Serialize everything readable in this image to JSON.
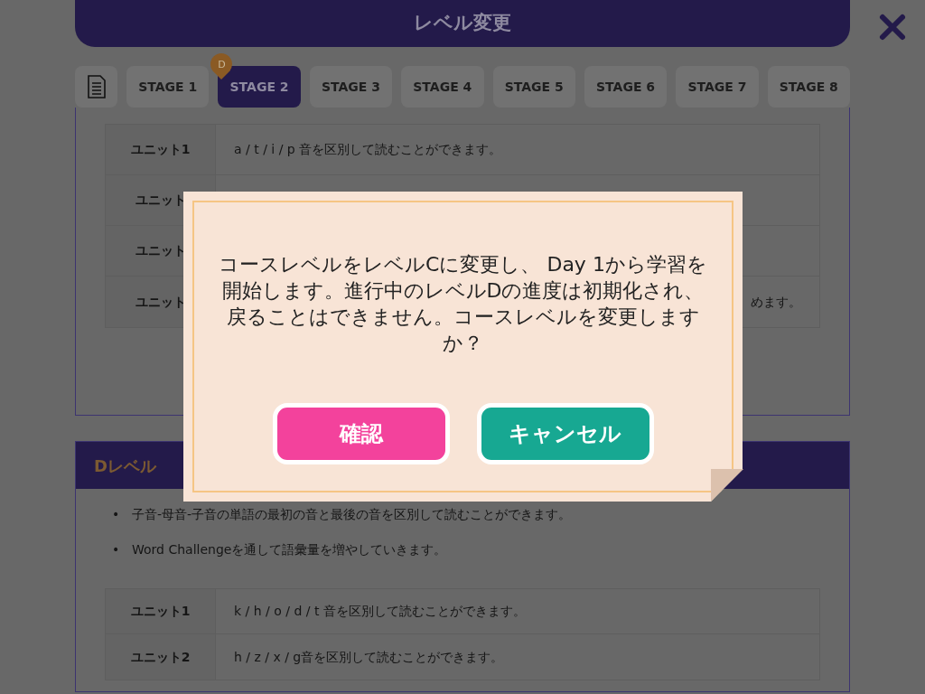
{
  "header": {
    "title": "レベル変更"
  },
  "tabs": [
    {
      "label": "STAGE 1",
      "selected": false
    },
    {
      "label": "STAGE 2",
      "selected": true,
      "badge": "D"
    },
    {
      "label": "STAGE 3",
      "selected": false
    },
    {
      "label": "STAGE 4",
      "selected": false
    },
    {
      "label": "STAGE 5",
      "selected": false
    },
    {
      "label": "STAGE 6",
      "selected": false
    },
    {
      "label": "STAGE 7",
      "selected": false
    },
    {
      "label": "STAGE 8",
      "selected": false
    }
  ],
  "sections": [
    {
      "units": [
        {
          "unit": "ユニット1",
          "description": "a / t / i / p 音を区別して読むことができます。"
        },
        {
          "unit": "ユニット"
        },
        {
          "unit": "ユニット"
        },
        {
          "unit": "ユニット",
          "description": "めます。"
        }
      ]
    },
    {
      "title": "Dレベル",
      "bullets": [
        {
          "marker": "•",
          "text": "子音-母音-子音の単語の最初の音と最後の音を区別して読むことができます。"
        },
        {
          "marker": "•",
          "text": "Word Challengeを通して語彙量を増やしていきます。"
        }
      ],
      "units": [
        {
          "unit": "ユニット1",
          "description": "k / h / o / d / t 音を区別して読むことができます。"
        },
        {
          "unit": "ユニット2",
          "description": "h / z / x / g音を区別して読むことができます。"
        }
      ]
    }
  ],
  "dialog": {
    "message": "コースレベルをレベルCに変更し、 Day 1から学習を開始します。進行中のレベルDの進度は初期化され、戻ることはできません。コースレベルを変更しますか？",
    "buttons": [
      {
        "label": "確認",
        "kind": "confirm"
      },
      {
        "label": "キャンセル",
        "kind": "cancel"
      }
    ]
  }
}
